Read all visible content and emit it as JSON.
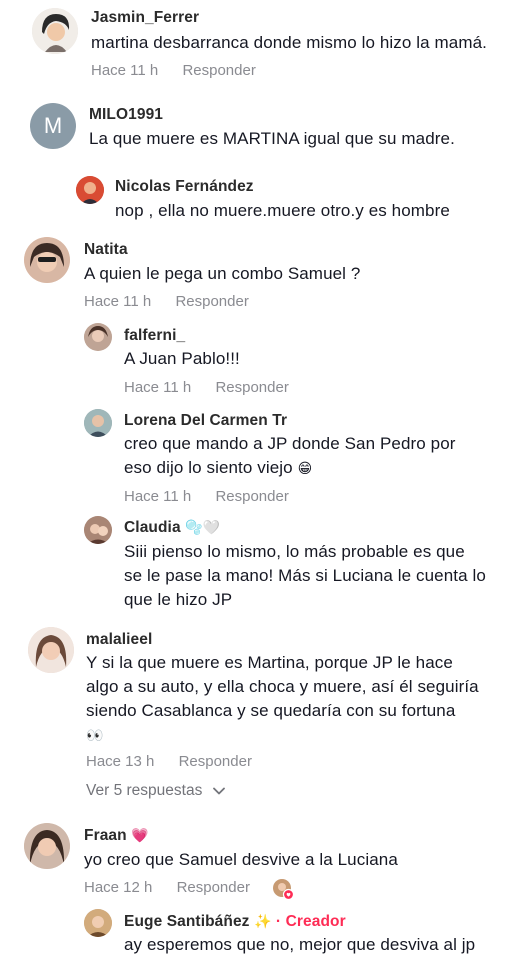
{
  "comments": [
    {
      "username": "Jasmin_Ferrer",
      "text": "martina desbarranca donde mismo lo hizo la mamá.",
      "time": "Hace 11 h",
      "reply": "Responder"
    },
    {
      "username": "MILO1991",
      "avatar_letter": "M",
      "text": "La que muere es MARTINA igual que su madre.",
      "replies": [
        {
          "username": "Nicolas Fernández",
          "text": "nop , ella no muere.muere otro.y es hombre"
        }
      ]
    },
    {
      "username": "Natita",
      "text": "A quien le pega un combo Samuel ?",
      "time": "Hace 11 h",
      "reply": "Responder",
      "replies": [
        {
          "username": "falferni_",
          "text": "A Juan Pablo!!!",
          "time": "Hace 11 h",
          "reply": "Responder"
        },
        {
          "username": "Lorena Del Carmen Tr",
          "text_line1": "creo que mando a JP donde San Pedro por",
          "text_line2": "eso dijo lo siento viejo",
          "emoji": "😁",
          "time": "Hace 11 h",
          "reply": "Responder"
        },
        {
          "username": "Claudia",
          "badge": "🫧🤍",
          "text_line1": "Siii pienso lo mismo, lo más probable es que",
          "text_line2": "se le pase la mano! Más si Luciana le cuenta lo",
          "text_line3": "que le hizo JP"
        }
      ]
    },
    {
      "username": "malalieel",
      "text_line1": "Y si la que muere es Martina, porque JP le hace",
      "text_line2": "algo a su auto, y ella choca y muere, así él seguiría",
      "text_line3": "siendo Casablanca y se quedaría con su fortuna",
      "emoji": "👀",
      "time": "Hace 13 h",
      "reply": "Responder",
      "view_more": "Ver 5 respuestas"
    },
    {
      "username": "Fraan",
      "badge": "💗",
      "text": "yo creo que Samuel desvive a la Luciana",
      "time": "Hace 12 h",
      "reply": "Responder",
      "replies": [
        {
          "username": "Euge Santibáñez",
          "badge": "✨",
          "creator_sep": "·",
          "creator_label": "Creador",
          "text": "ay esperemos que no, mejor que desviva al jp"
        }
      ]
    }
  ],
  "colors": {
    "accent": "#fe2c55",
    "muted": "#8a8b91",
    "text": "#161823"
  }
}
